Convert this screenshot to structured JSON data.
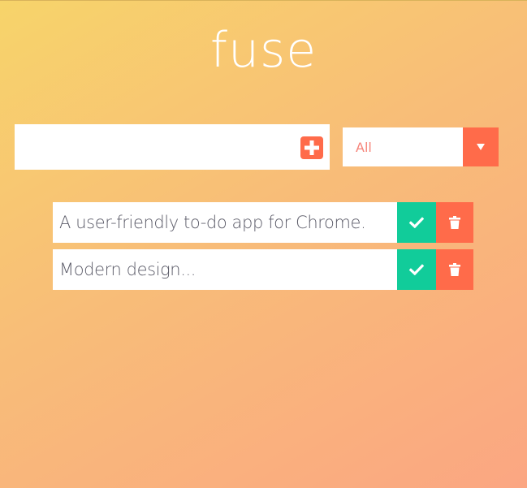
{
  "app": {
    "title": "fuse"
  },
  "new_todo": {
    "value": "",
    "placeholder": "",
    "add_icon": "plus-square-icon"
  },
  "filter": {
    "selected": "All",
    "arrow_icon": "caret-down-icon"
  },
  "todos": [
    {
      "text": "A user-friendly to-do app for Chrome.",
      "complete_icon": "check-icon",
      "delete_icon": "trash-icon"
    },
    {
      "text": "Modern design...",
      "complete_icon": "check-icon",
      "delete_icon": "trash-icon"
    }
  ],
  "colors": {
    "gradient_start": "#f7d46a",
    "gradient_end": "#fba682",
    "accent": "#ff6b4a",
    "complete": "#11cc9a",
    "filter_text": "#f6847a",
    "todo_text": "#5b5b68"
  }
}
